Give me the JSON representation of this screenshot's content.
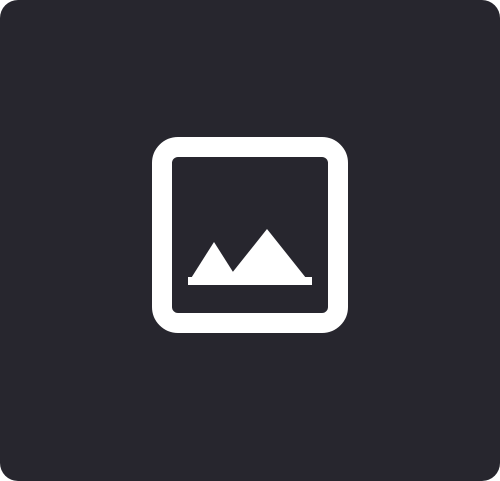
{
  "tile": {
    "background_color": "#27262e",
    "icon": {
      "name": "image-icon",
      "color": "#ffffff"
    }
  }
}
